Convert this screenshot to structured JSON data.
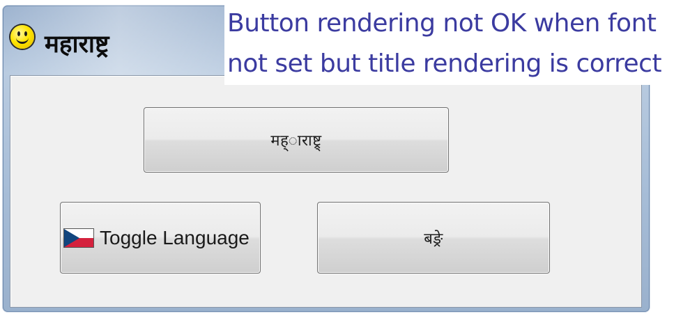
{
  "window": {
    "title": "महाराष्ट्र",
    "icon": "smiley-icon"
  },
  "buttons": {
    "top_label": "मह्ाराष्ट्र्",
    "toggle_language_label": "Toggle Language",
    "toggle_language_icon": "czech-flag-icon",
    "right_label": "बङ्रे"
  },
  "annotation": {
    "line1": "Button rendering not OK when font",
    "line2": "not set but title rendering is correct",
    "color": "#3b3ba0"
  }
}
